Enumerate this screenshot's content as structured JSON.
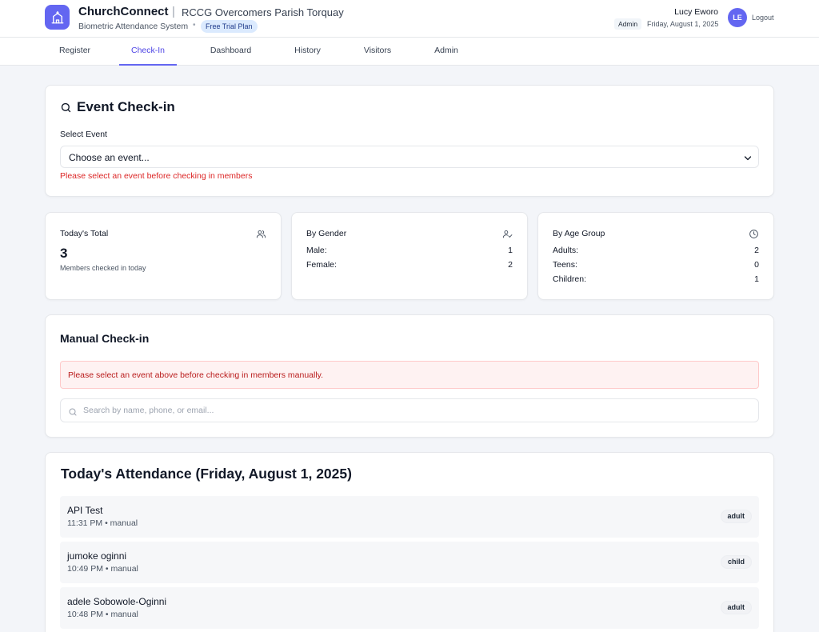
{
  "header": {
    "app_name": "ChurchConnect",
    "separator": "|",
    "parish": "RCCG Overcomers Parish Torquay",
    "subtitle": "Biometric Attendance System",
    "dot": "•",
    "plan": "Free Trial Plan",
    "user_name": "Lucy Eworo",
    "role": "Admin",
    "date": "Friday, August 1, 2025",
    "avatar_initials": "LE",
    "logout": "Logout",
    "logo_icon": "church-icon"
  },
  "nav": {
    "tabs": [
      {
        "label": "Register"
      },
      {
        "label": "Check-In"
      },
      {
        "label": "Dashboard"
      },
      {
        "label": "History"
      },
      {
        "label": "Visitors"
      },
      {
        "label": "Admin"
      }
    ],
    "active": "Check-In"
  },
  "event_checkin": {
    "title": "Event Check-in",
    "select_label": "Select Event",
    "select_value": "Choose an event...",
    "error": "Please select an event before checking in members"
  },
  "stats": {
    "total": {
      "title": "Today's Total",
      "value": "3",
      "caption": "Members checked in today",
      "icon": "users-icon"
    },
    "gender": {
      "title": "By Gender",
      "icon": "user-check-icon",
      "rows": [
        {
          "label": "Male:",
          "value": "1"
        },
        {
          "label": "Female:",
          "value": "2"
        }
      ]
    },
    "age": {
      "title": "By Age Group",
      "icon": "clock-icon",
      "rows": [
        {
          "label": "Adults:",
          "value": "2"
        },
        {
          "label": "Teens:",
          "value": "0"
        },
        {
          "label": "Children:",
          "value": "1"
        }
      ]
    }
  },
  "manual_checkin": {
    "title": "Manual Check-in",
    "alert": "Please select an event above before checking in members manually.",
    "search_placeholder": "Search by name, phone, or email..."
  },
  "attendance": {
    "title": "Today's Attendance (Friday, August 1, 2025)",
    "rows": [
      {
        "name": "API Test",
        "meta": "11:31 PM • manual",
        "badge": "adult"
      },
      {
        "name": "jumoke oginni",
        "meta": "10:49 PM • manual",
        "badge": "child"
      },
      {
        "name": "adele Sobowole-Oginni",
        "meta": "10:48 PM • manual",
        "badge": "adult"
      }
    ]
  },
  "colors": {
    "accent": "#6366f1",
    "active_tab": "#4f46e5",
    "error": "#dc2626",
    "alert_bg": "#fef2f2",
    "badge_bg": "#dbeafe"
  }
}
